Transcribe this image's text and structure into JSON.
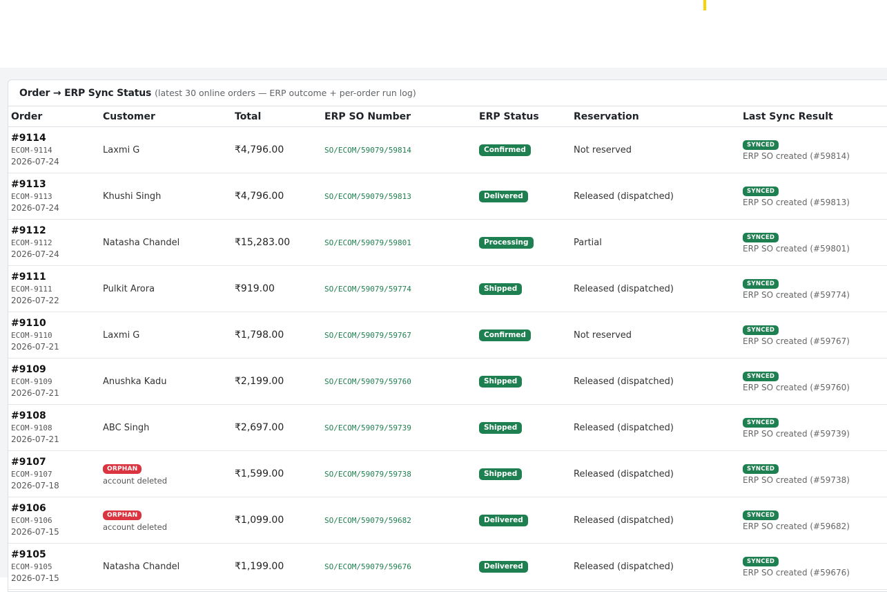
{
  "panel": {
    "title": "Order → ERP Sync Status",
    "subtitle": "(latest 30 online orders — ERP outcome + per-order run log)"
  },
  "columns": [
    "Order",
    "Customer",
    "Total",
    "ERP SO Number",
    "ERP Status",
    "Reservation",
    "Last Sync Result"
  ],
  "rows": [
    {
      "order": "#9114",
      "code": "ECOM-9114",
      "date": "2026-07-24",
      "customer": "Laxmi G",
      "orphan": false,
      "orphan_label": "",
      "orphan_note": "",
      "total": "₹4,796.00",
      "so": "SO/ECOM/59079/59814",
      "status": "Confirmed",
      "reservation": "Not reserved",
      "sync": "SYNCED",
      "sync_note": "ERP SO created (#59814)"
    },
    {
      "order": "#9113",
      "code": "ECOM-9113",
      "date": "2026-07-24",
      "customer": "Khushi Singh",
      "orphan": false,
      "orphan_label": "",
      "orphan_note": "",
      "total": "₹4,796.00",
      "so": "SO/ECOM/59079/59813",
      "status": "Delivered",
      "reservation": "Released (dispatched)",
      "sync": "SYNCED",
      "sync_note": "ERP SO created (#59813)"
    },
    {
      "order": "#9112",
      "code": "ECOM-9112",
      "date": "2026-07-24",
      "customer": "Natasha Chandel",
      "orphan": false,
      "orphan_label": "",
      "orphan_note": "",
      "total": "₹15,283.00",
      "so": "SO/ECOM/59079/59801",
      "status": "Processing",
      "reservation": "Partial",
      "sync": "SYNCED",
      "sync_note": "ERP SO created (#59801)"
    },
    {
      "order": "#9111",
      "code": "ECOM-9111",
      "date": "2026-07-22",
      "customer": "Pulkit Arora",
      "orphan": false,
      "orphan_label": "",
      "orphan_note": "",
      "total": "₹919.00",
      "so": "SO/ECOM/59079/59774",
      "status": "Shipped",
      "reservation": "Released (dispatched)",
      "sync": "SYNCED",
      "sync_note": "ERP SO created (#59774)"
    },
    {
      "order": "#9110",
      "code": "ECOM-9110",
      "date": "2026-07-21",
      "customer": "Laxmi G",
      "orphan": false,
      "orphan_label": "",
      "orphan_note": "",
      "total": "₹1,798.00",
      "so": "SO/ECOM/59079/59767",
      "status": "Confirmed",
      "reservation": "Not reserved",
      "sync": "SYNCED",
      "sync_note": "ERP SO created (#59767)"
    },
    {
      "order": "#9109",
      "code": "ECOM-9109",
      "date": "2026-07-21",
      "customer": "Anushka Kadu",
      "orphan": false,
      "orphan_label": "",
      "orphan_note": "",
      "total": "₹2,199.00",
      "so": "SO/ECOM/59079/59760",
      "status": "Shipped",
      "reservation": "Released (dispatched)",
      "sync": "SYNCED",
      "sync_note": "ERP SO created (#59760)"
    },
    {
      "order": "#9108",
      "code": "ECOM-9108",
      "date": "2026-07-21",
      "customer": "ABC Singh",
      "orphan": false,
      "orphan_label": "",
      "orphan_note": "",
      "total": "₹2,697.00",
      "so": "SO/ECOM/59079/59739",
      "status": "Shipped",
      "reservation": "Released (dispatched)",
      "sync": "SYNCED",
      "sync_note": "ERP SO created (#59739)"
    },
    {
      "order": "#9107",
      "code": "ECOM-9107",
      "date": "2026-07-18",
      "customer": "",
      "orphan": true,
      "orphan_label": "ORPHAN",
      "orphan_note": "account deleted",
      "total": "₹1,599.00",
      "so": "SO/ECOM/59079/59738",
      "status": "Shipped",
      "reservation": "Released (dispatched)",
      "sync": "SYNCED",
      "sync_note": "ERP SO created (#59738)"
    },
    {
      "order": "#9106",
      "code": "ECOM-9106",
      "date": "2026-07-15",
      "customer": "",
      "orphan": true,
      "orphan_label": "ORPHAN",
      "orphan_note": "account deleted",
      "total": "₹1,099.00",
      "so": "SO/ECOM/59079/59682",
      "status": "Delivered",
      "reservation": "Released (dispatched)",
      "sync": "SYNCED",
      "sync_note": "ERP SO created (#59682)"
    },
    {
      "order": "#9105",
      "code": "ECOM-9105",
      "date": "2026-07-15",
      "customer": "Natasha Chandel",
      "orphan": false,
      "orphan_label": "",
      "orphan_note": "",
      "total": "₹1,199.00",
      "so": "SO/ECOM/59079/59676",
      "status": "Delivered",
      "reservation": "Released (dispatched)",
      "sync": "SYNCED",
      "sync_note": "ERP SO created (#59676)"
    }
  ]
}
